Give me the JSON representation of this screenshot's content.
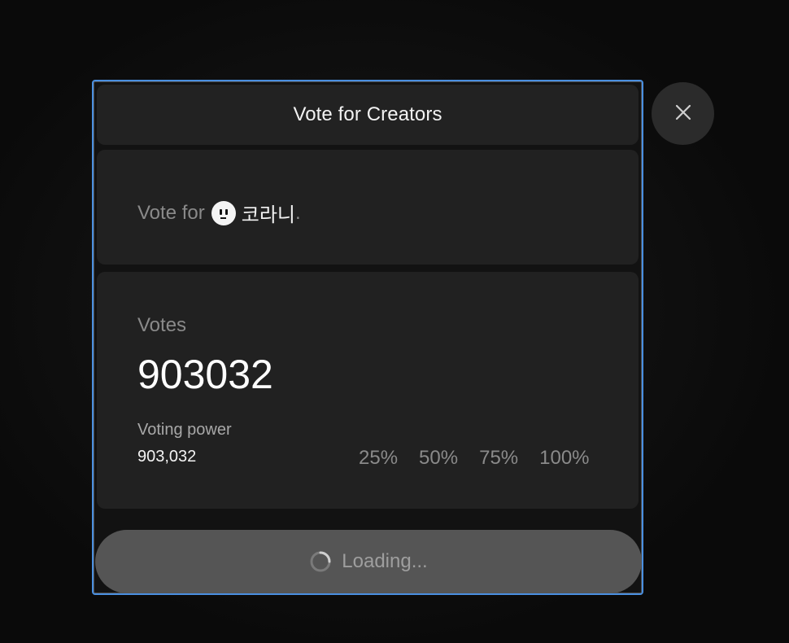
{
  "modal": {
    "title": "Vote for Creators"
  },
  "target": {
    "prefix": "Vote for",
    "creator_name": "코라니",
    "suffix": ".",
    "avatar_icon": "smiley-face-icon"
  },
  "votes": {
    "label": "Votes",
    "value": "903032"
  },
  "voting_power": {
    "label": "Voting power",
    "value": "903,032"
  },
  "percent_options": [
    "25%",
    "50%",
    "75%",
    "100%"
  ],
  "submit": {
    "label": "Loading...",
    "icon": "spinner-icon"
  },
  "close": {
    "icon": "close-icon"
  },
  "colors": {
    "accent_border": "#4a8fe0",
    "card_bg": "#212121",
    "button_bg": "#555555"
  }
}
